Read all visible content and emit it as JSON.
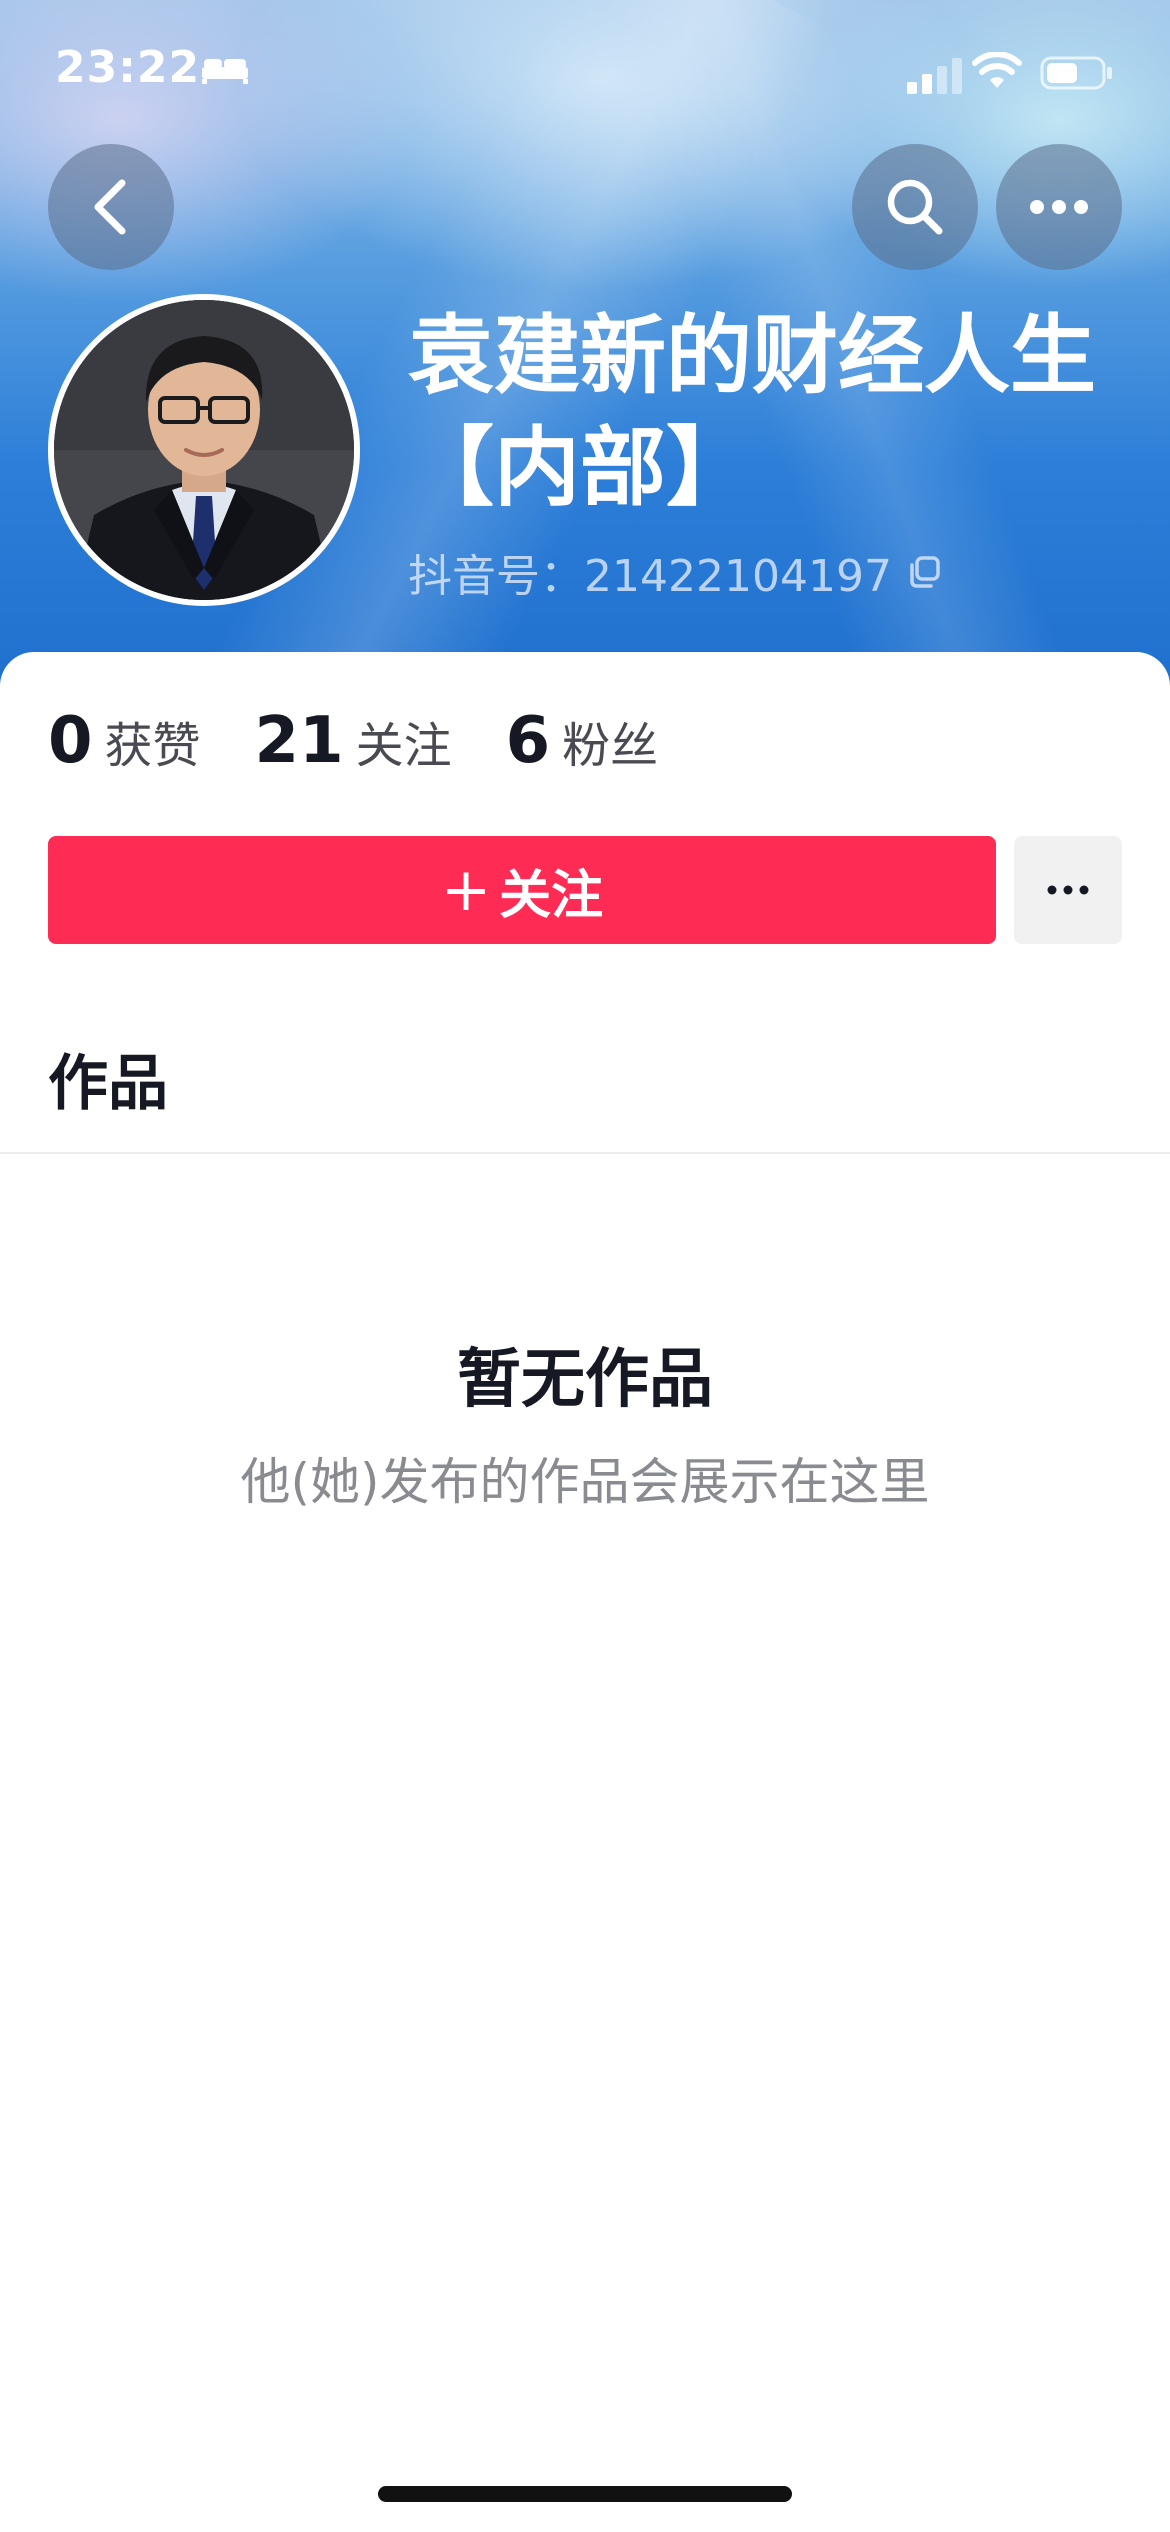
{
  "status_bar": {
    "time": "23:22",
    "sleep_icon": "bed-icon",
    "signal_icon": "cellular-signal-icon",
    "wifi_icon": "wifi-icon",
    "battery_icon": "battery-icon"
  },
  "nav": {
    "back_icon": "chevron-left-icon",
    "search_icon": "search-icon",
    "more_icon": "ellipsis-icon"
  },
  "profile": {
    "name": "袁建新的财经人生【内部】",
    "id_text": "抖音号：21422104197",
    "copy_icon": "copy-icon"
  },
  "stats": [
    {
      "value": "0",
      "label": "获赞"
    },
    {
      "value": "21",
      "label": "关注"
    },
    {
      "value": "6",
      "label": "粉丝"
    }
  ],
  "actions": {
    "follow_plus": "+",
    "follow_label": "关注",
    "more_icon": "ellipsis-icon"
  },
  "tabs": {
    "works": "作品"
  },
  "empty_state": {
    "title": "暂无作品",
    "subtitle": "他(她)发布的作品会展示在这里"
  },
  "colors": {
    "accent": "#fe2c55",
    "header_blue": "#2c7ed8",
    "text_primary": "#161823",
    "text_secondary": "#8a8b91"
  }
}
